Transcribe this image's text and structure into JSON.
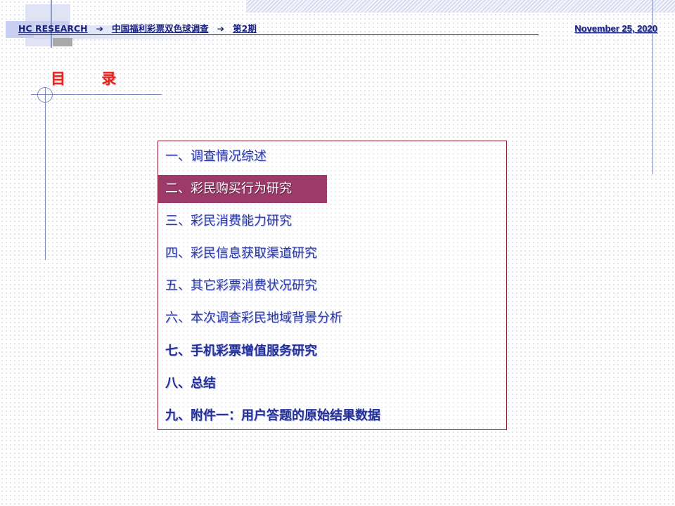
{
  "header": {
    "company": "HC RESEARCH",
    "project": "中国福利彩票双色球调查",
    "issue": "第2期",
    "arrow": "➔",
    "date": "November 25, 2020"
  },
  "title": "目 录",
  "toc": [
    {
      "label": "一、调查情况综述"
    },
    {
      "label": "二、彩民购买行为研究"
    },
    {
      "label": "三、彩民消费能力研究"
    },
    {
      "label": "四、彩民信息获取渠道研究"
    },
    {
      "label": "五、其它彩票消费状况研究"
    },
    {
      "label": "六、本次调查彩民地域背景分析"
    },
    {
      "label": "七、手机彩票增值服务研究"
    },
    {
      "label": "八、总结"
    },
    {
      "label": "九、附件一：用户答题的原始结果数据"
    }
  ],
  "colors": {
    "title": "#e8231d",
    "text": "#2c3aa8",
    "highlight": "#9c3b6a",
    "border": "#8b1a2e"
  }
}
